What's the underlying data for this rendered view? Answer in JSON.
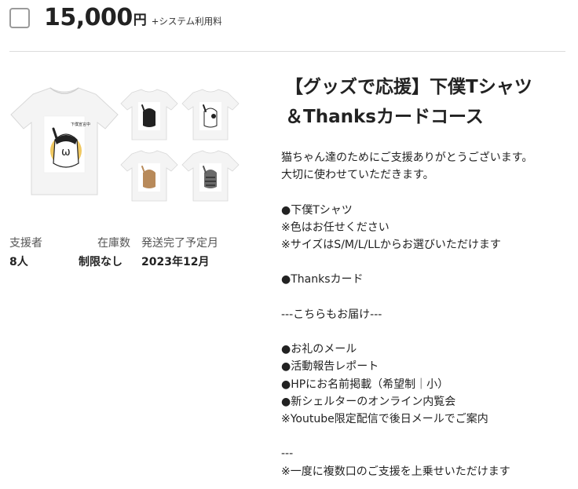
{
  "header": {
    "price": "15,000",
    "currency": "円",
    "fee_note": "+システム利用料"
  },
  "stats": {
    "supporters_label": "支援者",
    "supporters_value": "8人",
    "stock_label": "在庫数",
    "stock_value": "制限なし",
    "delivery_label": "発送完了予定月",
    "delivery_value": "2023年12月"
  },
  "reward": {
    "title_line1": "【グッズで応援】下僕Tシャツ",
    "title_line2": "＆Thanksカードコース",
    "description": [
      "猫ちゃん達のためにご支援ありがとうございます。",
      "大切に使わせていただきます。",
      "",
      "●下僕Tシャツ",
      "※色はお任せください",
      "※サイズはS/M/L/LLからお選びいただけます",
      "",
      "●Thanksカード",
      "",
      "---こちらもお届け---",
      "",
      "●お礼のメール",
      "●活動報告レポート",
      "●HPにお名前掲載（希望制｜小）",
      "●新シェルターのオンライン内覧会",
      "※Youtube限定配信で後日メールでご案内",
      "",
      "---",
      "※一度に複数口のご支援を上乗せいただけます"
    ]
  },
  "image": {
    "shirt_label": "下僕宣言中"
  }
}
